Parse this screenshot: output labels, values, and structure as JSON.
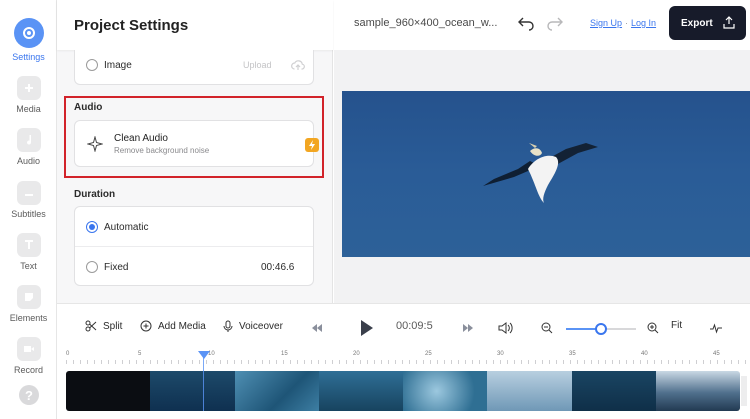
{
  "rail": {
    "items": [
      {
        "label": "Settings",
        "icon": "settings-icon"
      },
      {
        "label": "Media",
        "icon": "plus-icon"
      },
      {
        "label": "Audio",
        "icon": "music-note-icon"
      },
      {
        "label": "Subtitles",
        "icon": "subtitles-icon"
      },
      {
        "label": "Text",
        "icon": "text-icon"
      },
      {
        "label": "Elements",
        "icon": "elements-icon"
      },
      {
        "label": "Record",
        "icon": "record-icon"
      }
    ],
    "help": "?"
  },
  "panel": {
    "title": "Project Settings",
    "image_option": {
      "label": "Image",
      "action": "Upload"
    },
    "audio": {
      "section": "Audio",
      "clean_title": "Clean Audio",
      "clean_subtitle": "Remove background noise"
    },
    "duration": {
      "section": "Duration",
      "automatic": "Automatic",
      "fixed": "Fixed",
      "fixed_value": "00:46.6"
    }
  },
  "topbar": {
    "filename": "sample_960×400_ocean_w...",
    "sign_up": "Sign Up",
    "separator": "·",
    "log_in": "Log In",
    "export": "Export"
  },
  "toolbar": {
    "split": "Split",
    "add_media": "Add Media",
    "voiceover": "Voiceover",
    "time": "00:09:5",
    "fit": "Fit",
    "zoom_level": 0.5
  },
  "ruler": {
    "labels": [
      "0",
      "5",
      "10",
      "15",
      "20",
      "25",
      "30",
      "35",
      "40",
      "45"
    ]
  },
  "colors": {
    "accent": "#3a76ee",
    "highlight_border": "#d2232a",
    "export_bg": "#171b2a",
    "video_bg": "#2a5c97"
  }
}
